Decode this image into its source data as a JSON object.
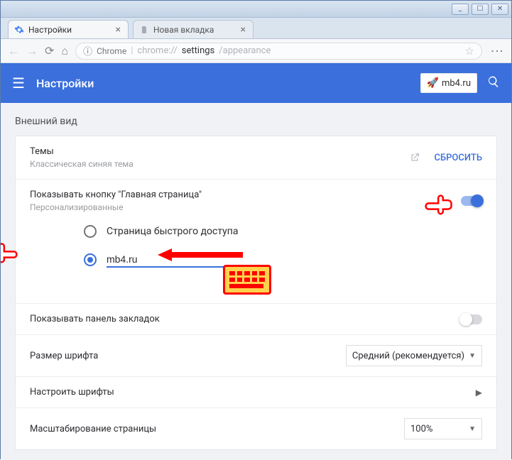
{
  "window": {
    "min": "_",
    "max": "☐",
    "close": "✕"
  },
  "tabs": [
    {
      "title": "Настройки",
      "kind": "settings"
    },
    {
      "title": "Новая вкладка",
      "kind": "page"
    }
  ],
  "addressbar": {
    "secure_label": "Chrome",
    "url_prefix": "chrome://",
    "url_path_bold": "settings",
    "url_suffix": "/appearance"
  },
  "header": {
    "title": "Настройки",
    "badge_text": "mb4.ru"
  },
  "section": {
    "title": "Внешний вид"
  },
  "themes": {
    "title": "Темы",
    "subtitle": "Классическая синяя тема",
    "reset_label": "СБРОСИТЬ"
  },
  "homebutton": {
    "title": "Показывать кнопку \"Главная страница\"",
    "subtitle": "Персонализированные",
    "toggle_on": true,
    "radio_quick_label": "Страница быстрого доступа",
    "url_value": "mb4.ru"
  },
  "bookmarks": {
    "title": "Показывать панель закладок",
    "toggle_on": false
  },
  "fontsize": {
    "title": "Размер шрифта",
    "value": "Средний (рекомендуется)"
  },
  "customfonts": {
    "title": "Настроить шрифты"
  },
  "zoom": {
    "title": "Масштабирование страницы",
    "value": "100%"
  }
}
